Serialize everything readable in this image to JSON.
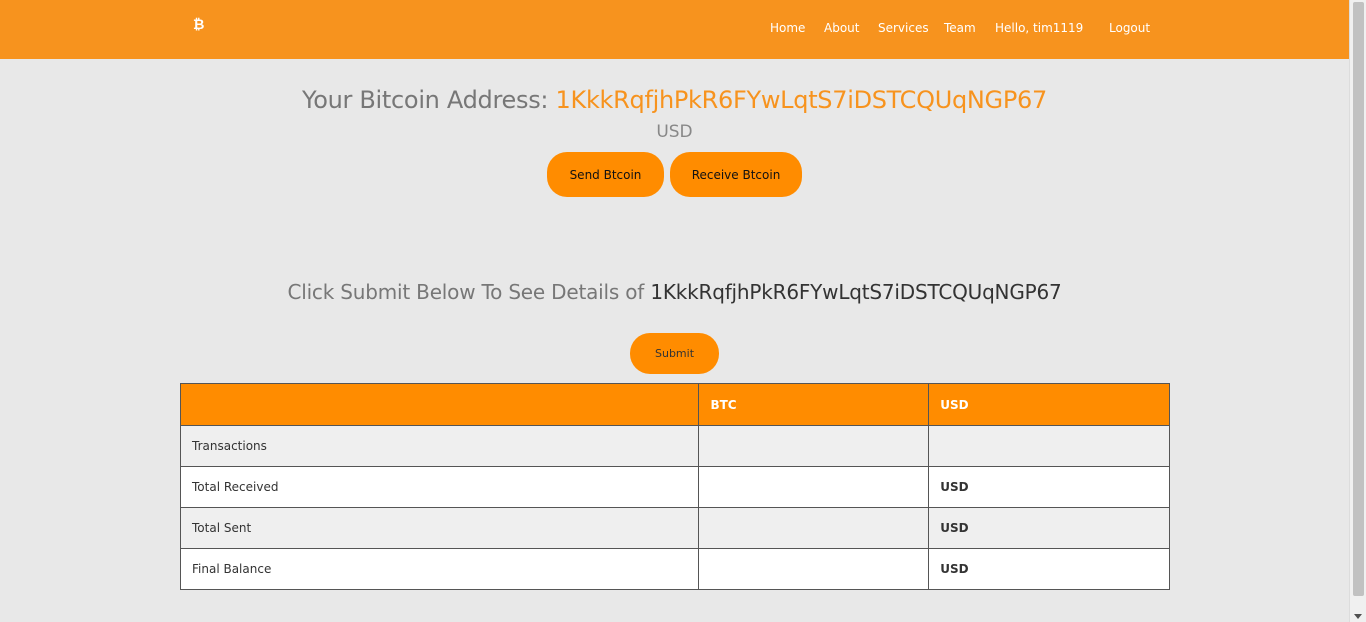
{
  "nav": {
    "brand": "₿",
    "items": [
      "Home",
      "About",
      "Services",
      "Team",
      "Hello, tim1119",
      "Logout"
    ]
  },
  "address": {
    "label": "Your Bitcoin Address: ",
    "value": "1KkkRqfjhPkR6FYwLqtS7iDSTCQUqNGP67",
    "currency": "USD"
  },
  "buttons": {
    "send": "Send Btcoin",
    "receive": "Receive Btcoin",
    "submit": "Submit"
  },
  "details": {
    "prefix": "Click Submit Below To See Details of ",
    "address": "1KkkRqfjhPkR6FYwLqtS7iDSTCQUqNGP67"
  },
  "table": {
    "headers": [
      "",
      "BTC",
      "USD"
    ],
    "rows": [
      {
        "label": "Transactions",
        "btc": "",
        "usd": ""
      },
      {
        "label": "Total Received",
        "btc": "",
        "usd": "USD"
      },
      {
        "label": "Total Sent",
        "btc": "",
        "usd": "USD"
      },
      {
        "label": "Final Balance",
        "btc": "",
        "usd": "USD"
      }
    ]
  },
  "colors": {
    "accent": "#f7931e",
    "button": "#ff8c00",
    "background": "#e8e8e8"
  }
}
